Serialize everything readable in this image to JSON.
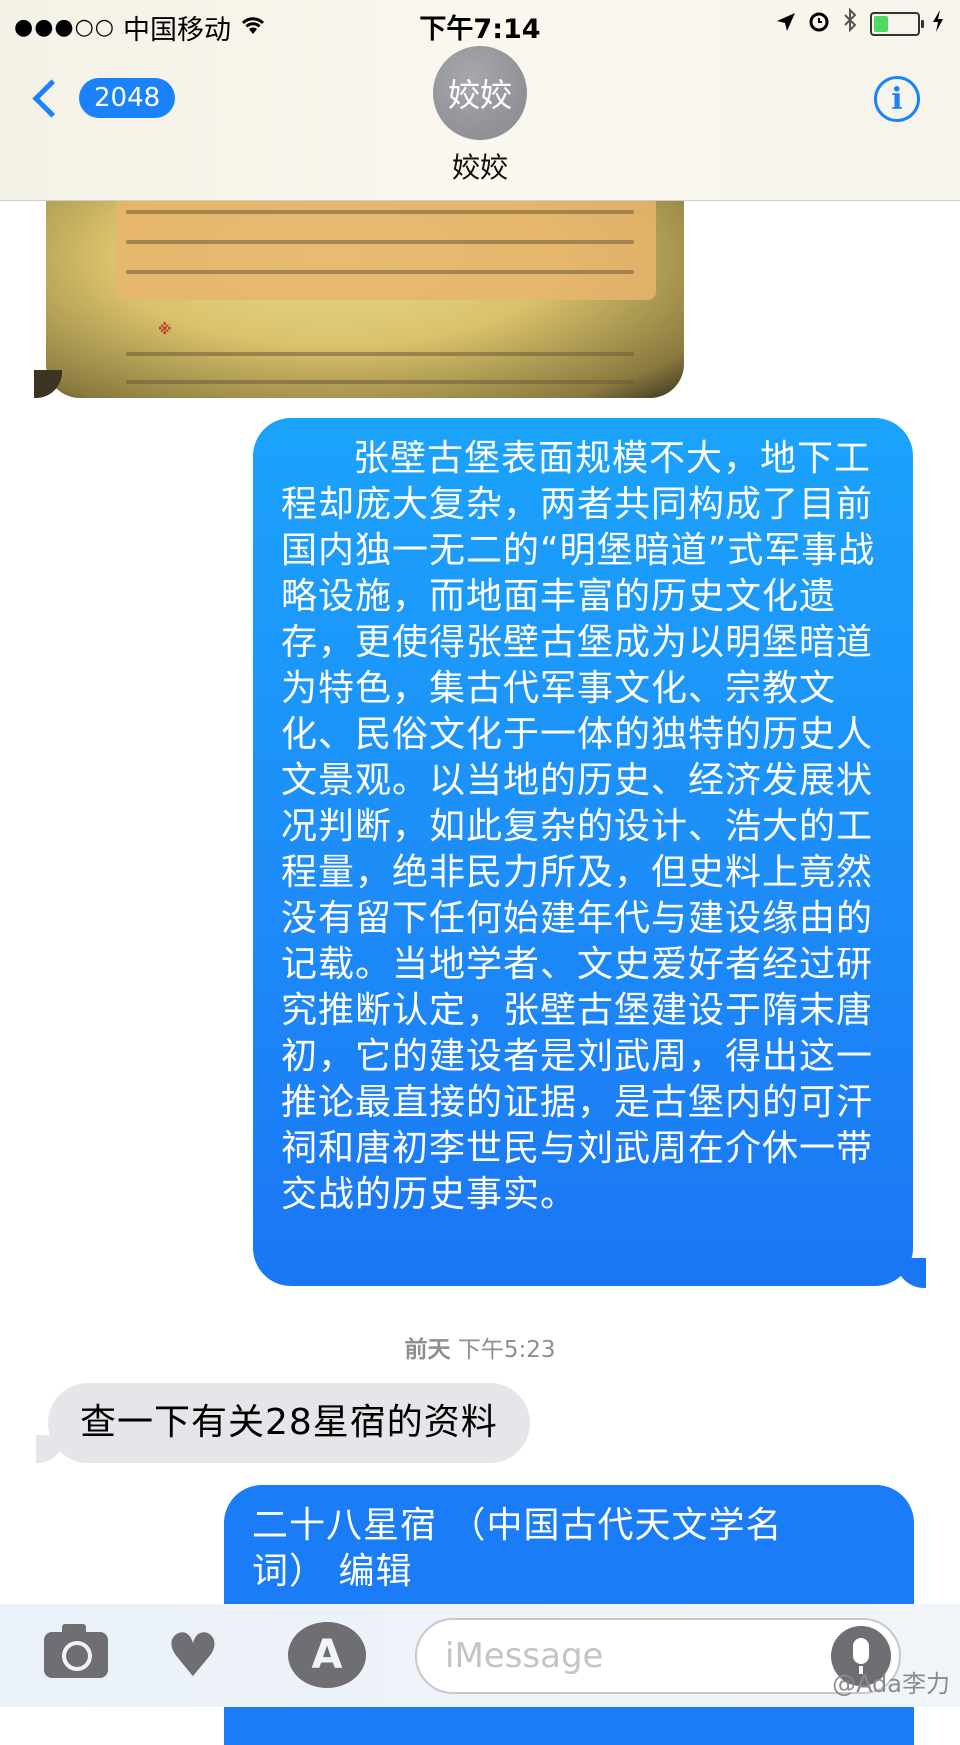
{
  "status_bar": {
    "signal": "●●●○○",
    "carrier": "中国移动",
    "wifi_icon": "wifi-icon",
    "time": "下午7:14",
    "icons": [
      "location-arrow-icon",
      "alarm-clock-icon",
      "bluetooth-icon",
      "battery-icon",
      "charging-bolt-icon"
    ],
    "battery_level": 0.3
  },
  "nav": {
    "back_count": "2048",
    "avatar_text": "姣姣",
    "contact_name": "姣姣",
    "info_label": "i"
  },
  "messages": {
    "sent_1": "张壁古堡表面规模不大，地下工程却庞大复杂，两者共同构成了目前国内独一无二的“明堡暗道”式军事战略设施，而地面丰富的历史文化遗存，更使得张壁古堡成为以明堡暗道为特色，集古代军事文化、宗教文化、民俗文化于一体的独特的历史人文景观。以当地的历史、经济发展状况判断，如此复杂的设计、浩大的工程量，绝非民力所及，但史料上竟然没有留下任何始建年代与建设缘由的记载。当地学者、文史爱好者经过研究推断认定，张壁古堡建设于隋末唐初，它的建设者是刘武周，得出这一推论最直接的证据，是古堡内的可汗祠和唐初李世民与刘武周在介休一带交战的历史事实。",
    "timestamp_day": "前天",
    "timestamp_time": "下午5:23",
    "received_1": "查一下有关28星宿的资料",
    "sent_2_line1": "二十八星宿 （中国古代天文学名",
    "sent_2_line2": "词） 编辑"
  },
  "toolbar": {
    "input_placeholder": "iMessage",
    "watermark": "@Ada李力"
  },
  "colors": {
    "accent": "#1a82fb",
    "sent_bubble": "#1d8cf8",
    "received_bubble": "#e5e5ea"
  }
}
